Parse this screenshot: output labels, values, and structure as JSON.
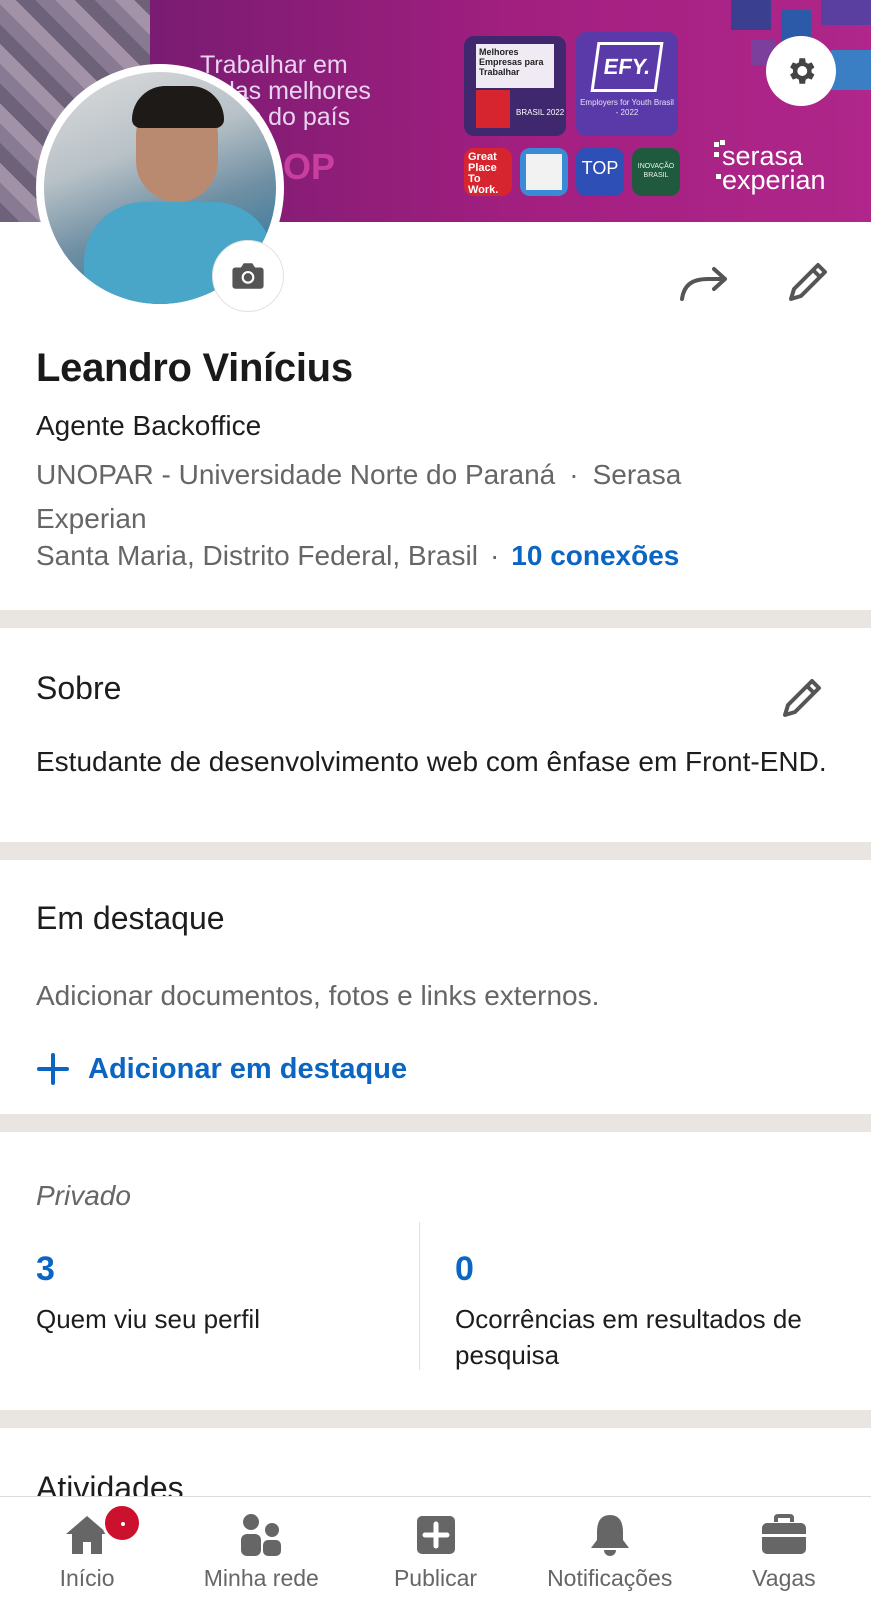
{
  "banner": {
    "tagline_line1": "Trabalhar em",
    "tagline_line2": "a das melhores",
    "tagline_line3": "resas do país",
    "tagline_fragment": "OP",
    "badge_melhores": "Melhores Empresas para Trabalhar",
    "badge_melhores_year": "BRASIL 2022",
    "badge_efy": "EFY.",
    "badge_efy_caption": "Employers for Youth Brasil - 2022",
    "badge_gptw": "Great Place To Work.",
    "badge_top": "TOP",
    "badge_inovacao": "INOVAÇÃO BRASIL",
    "logo_line1": "serasa",
    "logo_line2": "experian"
  },
  "profile": {
    "name": "Leandro Vinícius",
    "headline": "Agente Backoffice",
    "education": "UNOPAR - Universidade Norte do Paraná",
    "separator": "·",
    "company": "Serasa Experian",
    "location": "Santa Maria, Distrito Federal, Brasil",
    "connections": "10 conexões"
  },
  "about": {
    "title": "Sobre",
    "text": "Estudante de desenvolvimento web com ênfase em Front-END."
  },
  "featured": {
    "title": "Em destaque",
    "description": "Adicionar documentos, fotos e links externos.",
    "add_label": "Adicionar em destaque"
  },
  "private": {
    "title": "Privado",
    "stats": [
      {
        "value": "3",
        "label": "Quem viu seu perfil"
      },
      {
        "value": "0",
        "label": "Ocorrências em resultados de pesquisa"
      }
    ]
  },
  "activity": {
    "title": "Atividades"
  },
  "bottom_nav": [
    {
      "label": "Início",
      "icon": "home-icon"
    },
    {
      "label": "Minha rede",
      "icon": "network-icon"
    },
    {
      "label": "Publicar",
      "icon": "post-icon"
    },
    {
      "label": "Notificações",
      "icon": "bell-icon"
    },
    {
      "label": "Vagas",
      "icon": "briefcase-icon"
    }
  ],
  "colors": {
    "link_blue": "#0a66c2",
    "banner_magenta": "#a21f80",
    "divider": "#e9e6e1",
    "notification_red": "#cb112d",
    "secondary_text": "#666666"
  }
}
